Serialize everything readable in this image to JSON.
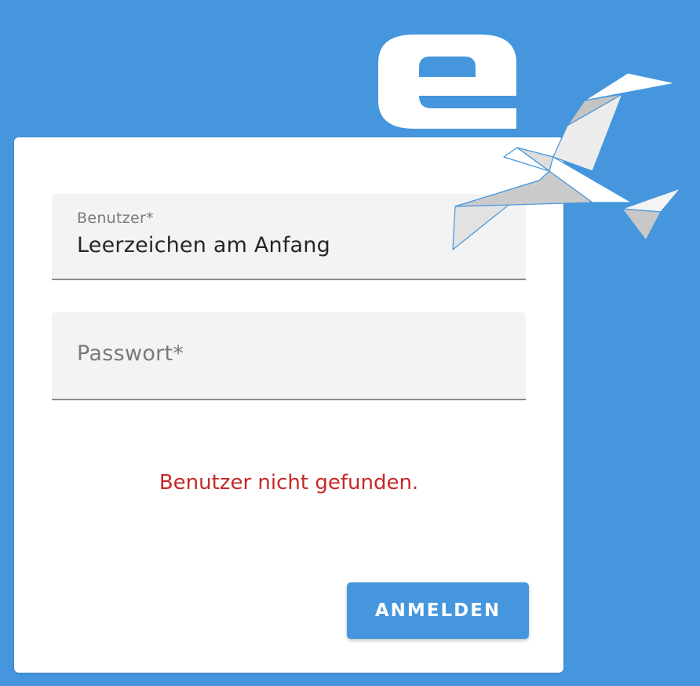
{
  "brand": {
    "logo_icon": "e-logo-icon",
    "bird_icon": "origami-bird-icon",
    "background_color": "#4596dd"
  },
  "login": {
    "username": {
      "label": "Benutzer*",
      "value": "Leerzeichen am Anfang"
    },
    "password": {
      "placeholder": "Passwort*",
      "value": ""
    },
    "error_message": "Benutzer nicht gefunden.",
    "error_color": "#c62828",
    "submit_label": "ANMELDEN"
  }
}
